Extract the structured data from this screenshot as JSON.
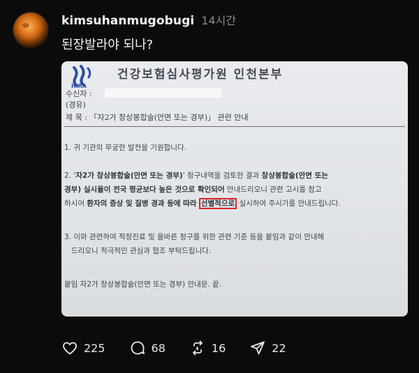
{
  "post": {
    "username": "kimsuhanmugobugi",
    "time": "14시간",
    "caption": "된장발라야 되나?"
  },
  "document": {
    "logo_text": "HIRA",
    "title": "건강보험심사평가원 인천본부",
    "recipient_label": "수신자 :",
    "via_label": "(경유)",
    "subject": "제  목 : 「자2가 창상봉합술(안면 또는 경부)」 관련 안내",
    "p1": "1. 귀 기관의 무궁한 발전을 기원합니다.",
    "p2_a_pre": "2. '",
    "p2_a_bold1": "자2가 창상봉합술(안면 또는 경부)",
    "p2_a_mid": "' 청구내역을 검토한 결과 ",
    "p2_a_bold2": "창상봉합술(안면 또는",
    "p2_b_bold": "경부) 실시율이 전국 평균보다 높은 것으로 확인되어",
    "p2_b_rest": " 안내드리오니 관련 고시를 참고",
    "p2_c_pre": "하시어 ",
    "p2_c_bold": "환자의 증상 및 질병 경과 등에 따라",
    "p2_c_highlight": "선별적으로",
    "p2_c_rest": " 실시하여 주시기를 안내드립니다.",
    "p3_a": "3. 이와 관련하여 적정진료 및 올바른 청구를 위한 관련 기준 등을 붙임과 같이 안내해",
    "p3_b": "드리오니 적극적인 관심과 협조 부탁드립니다.",
    "attachment": "붙임   자2가 창상봉합술(안면 또는 경부) 안내문.  끝."
  },
  "actions": {
    "likes": "225",
    "comments": "68",
    "reposts": "16",
    "shares": "22"
  },
  "colors": {
    "background": "#0b0b0b",
    "highlight_border": "#e0262a",
    "logo_blue": "#2e4fa0"
  }
}
